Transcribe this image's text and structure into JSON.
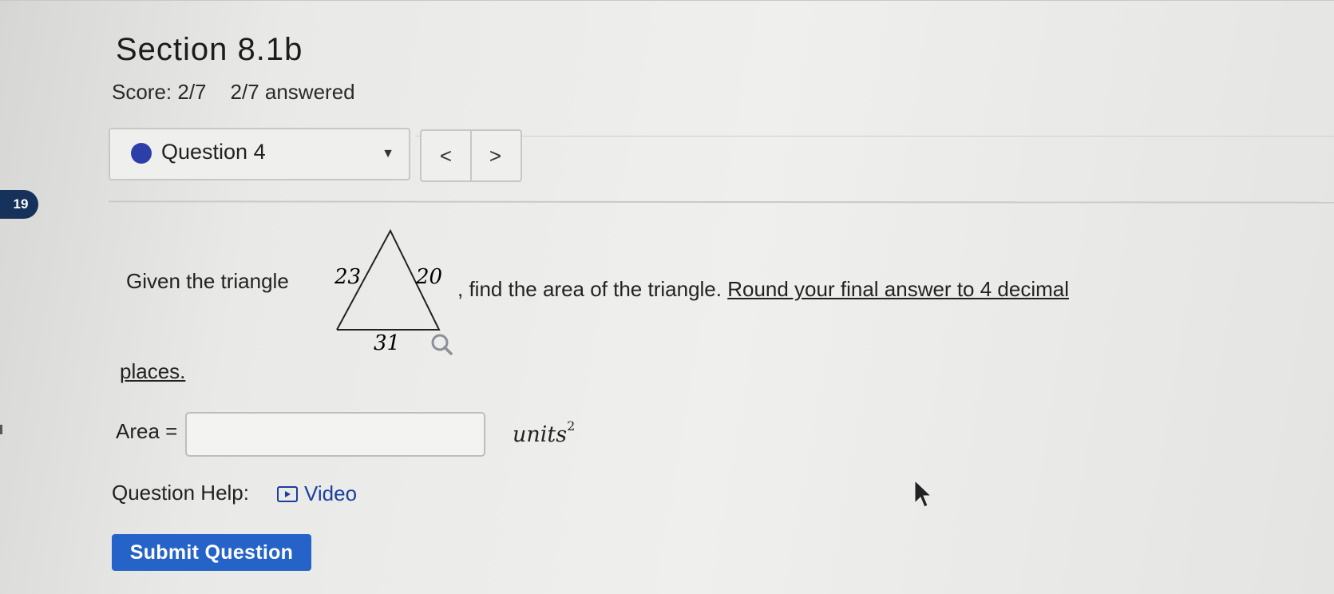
{
  "header": {
    "title": "Section 8.1b",
    "score": "Score: 2/7",
    "answered": "2/7 answered"
  },
  "question_nav": {
    "selected": "Question 4",
    "prev_label": "<",
    "next_label": ">"
  },
  "badge": "19",
  "question": {
    "prefix": "Given the triangle",
    "suffix": ", find the area of the triangle. ",
    "instruction": "Round your final answer to 4 decimal",
    "instruction_end": "places.",
    "triangle": {
      "left_side": "23",
      "right_side": "20",
      "base": "31"
    }
  },
  "answer": {
    "label": "Area =",
    "value": "",
    "units": "units",
    "units_exp": "2"
  },
  "help": {
    "label": "Question Help:",
    "video_label": "Video"
  },
  "submit_label": "Submit Question",
  "colors": {
    "accent": "#2563c9",
    "dot": "#2c3fa8",
    "badge": "#16315a",
    "link": "#1a3f9e"
  }
}
